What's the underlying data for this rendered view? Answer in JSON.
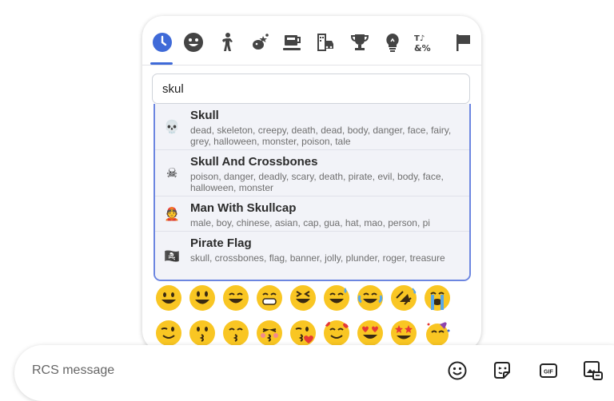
{
  "tabs": [
    {
      "icon": "recent-clock-icon"
    },
    {
      "icon": "smiley-icon"
    },
    {
      "icon": "person-icon"
    },
    {
      "icon": "animals-nature-icon"
    },
    {
      "icon": "food-drink-icon"
    },
    {
      "icon": "travel-places-icon"
    },
    {
      "icon": "activities-trophy-icon"
    },
    {
      "icon": "objects-lightbulb-icon"
    },
    {
      "icon": "symbols-icon"
    },
    {
      "icon": "flags-icon"
    }
  ],
  "search": {
    "value": "skul"
  },
  "results": [
    {
      "emoji": "💀",
      "title": "Skull",
      "keywords": "dead, skeleton, creepy, death, dead, body, danger, face, fairy, grey, halloween, monster, poison, tale"
    },
    {
      "emoji": "☠",
      "title": "Skull And Crossbones",
      "keywords": "poison, danger, deadly, scary, death, pirate, evil, body, face, halloween, monster"
    },
    {
      "emoji": "👲",
      "title": "Man With Skullcap",
      "keywords": "male, boy, chinese, asian, cap, gua, hat, mao, person, pi"
    },
    {
      "emoji": "🏴‍☠️",
      "title": "Pirate Flag",
      "keywords": "skull, crossbones, flag, banner, jolly, plunder, roger, treasure"
    }
  ],
  "emoji_grid": {
    "row1": [
      "grinning",
      "smiley",
      "smile",
      "grin",
      "laughing",
      "sweat-smile",
      "joy",
      "rofl",
      "sob"
    ],
    "row2": [
      "wink",
      "kissing",
      "kissing-smiling",
      "kissing-closed-eyes",
      "kissing-heart",
      "smiling-hearts",
      "heart-eyes",
      "star-struck",
      "partying"
    ]
  },
  "composer": {
    "placeholder": "RCS message",
    "gif_label": "GIF"
  }
}
